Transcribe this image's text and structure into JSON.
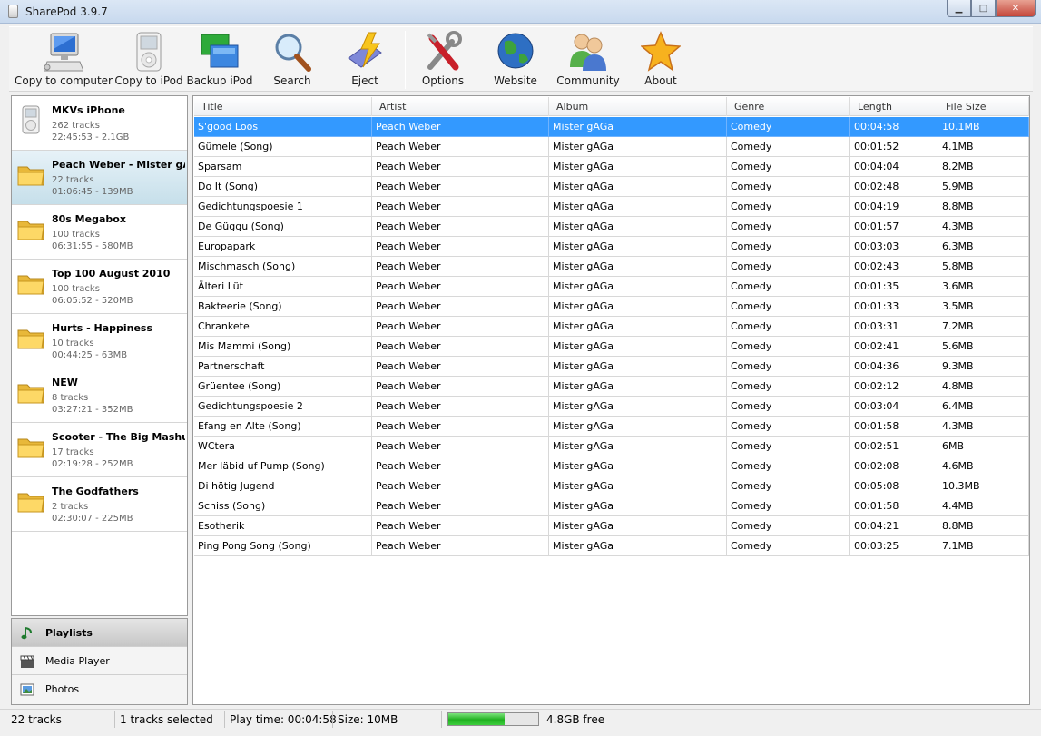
{
  "window": {
    "title": "SharePod 3.9.7",
    "min": "▁",
    "max": "□",
    "close": "✕"
  },
  "toolbar": [
    {
      "id": "copy-to-computer",
      "label": "Copy to computer",
      "icon": "computer-icon"
    },
    {
      "id": "copy-to-ipod",
      "label": "Copy to iPod",
      "icon": "ipod-icon"
    },
    {
      "id": "backup-ipod",
      "label": "Backup iPod",
      "icon": "backup-icon"
    },
    {
      "id": "search",
      "label": "Search",
      "icon": "magnifier-icon"
    },
    {
      "id": "eject",
      "label": "Eject",
      "icon": "eject-icon"
    },
    {
      "id": "options",
      "label": "Options",
      "icon": "tools-icon"
    },
    {
      "id": "website",
      "label": "Website",
      "icon": "globe-icon"
    },
    {
      "id": "community",
      "label": "Community",
      "icon": "people-icon"
    },
    {
      "id": "about",
      "label": "About",
      "icon": "star-icon"
    }
  ],
  "playlists": [
    {
      "name": "MKVs iPhone",
      "tracks": "262 tracks",
      "meta": "22:45:53 - 2.1GB",
      "icon": "ipod-icon",
      "selected": false
    },
    {
      "name": "Peach Weber - Mister gA",
      "tracks": "22 tracks",
      "meta": "01:06:45 - 139MB",
      "icon": "folder-icon",
      "selected": true
    },
    {
      "name": "80s Megabox",
      "tracks": "100 tracks",
      "meta": "06:31:55 - 580MB",
      "icon": "folder-icon",
      "selected": false
    },
    {
      "name": "Top 100 August 2010",
      "tracks": "100 tracks",
      "meta": "06:05:52 - 520MB",
      "icon": "folder-icon",
      "selected": false
    },
    {
      "name": "Hurts - Happiness",
      "tracks": "10 tracks",
      "meta": "00:44:25 - 63MB",
      "icon": "folder-icon",
      "selected": false
    },
    {
      "name": "NEW",
      "tracks": "8 tracks",
      "meta": "03:27:21 - 352MB",
      "icon": "folder-icon",
      "selected": false
    },
    {
      "name": "Scooter - The Big Mashup",
      "tracks": "17 tracks",
      "meta": "02:19:28 - 252MB",
      "icon": "folder-icon",
      "selected": false
    },
    {
      "name": "The Godfathers",
      "tracks": "2 tracks",
      "meta": "02:30:07 - 225MB",
      "icon": "folder-icon",
      "selected": false
    }
  ],
  "nav": [
    {
      "label": "Playlists",
      "icon": "music-note-icon",
      "active": true
    },
    {
      "label": "Media Player",
      "icon": "clapperboard-icon",
      "active": false
    },
    {
      "label": "Photos",
      "icon": "photo-icon",
      "active": false
    }
  ],
  "table": {
    "columns": [
      "Title",
      "Artist",
      "Album",
      "Genre",
      "Length",
      "File Size"
    ],
    "rows": [
      [
        "S'good Loos",
        "Peach Weber",
        "Mister gAGa",
        "Comedy",
        "00:04:58",
        "10.1MB"
      ],
      [
        "Gümele (Song)",
        "Peach Weber",
        "Mister gAGa",
        "Comedy",
        "00:01:52",
        "4.1MB"
      ],
      [
        "Sparsam",
        "Peach Weber",
        "Mister gAGa",
        "Comedy",
        "00:04:04",
        "8.2MB"
      ],
      [
        "Do It (Song)",
        "Peach Weber",
        "Mister gAGa",
        "Comedy",
        "00:02:48",
        "5.9MB"
      ],
      [
        "Gedichtungspoesie 1",
        "Peach Weber",
        "Mister gAGa",
        "Comedy",
        "00:04:19",
        "8.8MB"
      ],
      [
        "De Güggu (Song)",
        "Peach Weber",
        "Mister gAGa",
        "Comedy",
        "00:01:57",
        "4.3MB"
      ],
      [
        "Europapark",
        "Peach Weber",
        "Mister gAGa",
        "Comedy",
        "00:03:03",
        "6.3MB"
      ],
      [
        "Mischmasch (Song)",
        "Peach Weber",
        "Mister gAGa",
        "Comedy",
        "00:02:43",
        "5.8MB"
      ],
      [
        "Älteri Lüt",
        "Peach Weber",
        "Mister gAGa",
        "Comedy",
        "00:01:35",
        "3.6MB"
      ],
      [
        "Bakteerie (Song)",
        "Peach Weber",
        "Mister gAGa",
        "Comedy",
        "00:01:33",
        "3.5MB"
      ],
      [
        "Chrankete",
        "Peach Weber",
        "Mister gAGa",
        "Comedy",
        "00:03:31",
        "7.2MB"
      ],
      [
        "Mis Mammi (Song)",
        "Peach Weber",
        "Mister gAGa",
        "Comedy",
        "00:02:41",
        "5.6MB"
      ],
      [
        "Partnerschaft",
        "Peach Weber",
        "Mister gAGa",
        "Comedy",
        "00:04:36",
        "9.3MB"
      ],
      [
        "Grüentee (Song)",
        "Peach Weber",
        "Mister gAGa",
        "Comedy",
        "00:02:12",
        "4.8MB"
      ],
      [
        "Gedichtungspoesie 2",
        "Peach Weber",
        "Mister gAGa",
        "Comedy",
        "00:03:04",
        "6.4MB"
      ],
      [
        "Efang en Alte (Song)",
        "Peach Weber",
        "Mister gAGa",
        "Comedy",
        "00:01:58",
        "4.3MB"
      ],
      [
        "WCtera",
        "Peach Weber",
        "Mister gAGa",
        "Comedy",
        "00:02:51",
        "6MB"
      ],
      [
        "Mer läbid uf Pump (Song)",
        "Peach Weber",
        "Mister gAGa",
        "Comedy",
        "00:02:08",
        "4.6MB"
      ],
      [
        "Di hötig Jugend",
        "Peach Weber",
        "Mister gAGa",
        "Comedy",
        "00:05:08",
        "10.3MB"
      ],
      [
        "Schiss (Song)",
        "Peach Weber",
        "Mister gAGa",
        "Comedy",
        "00:01:58",
        "4.4MB"
      ],
      [
        "Esotherik",
        "Peach Weber",
        "Mister gAGa",
        "Comedy",
        "00:04:21",
        "8.8MB"
      ],
      [
        "Ping Pong Song (Song)",
        "Peach Weber",
        "Mister gAGa",
        "Comedy",
        "00:03:25",
        "7.1MB"
      ]
    ],
    "selected_row": 0
  },
  "status": {
    "tracks": "22 tracks",
    "selected": "1 tracks selected",
    "playtime": "Play time: 00:04:58",
    "size": "Size: 10MB",
    "free": "4.8GB free",
    "used_fraction": 0.63
  },
  "colors": {
    "selection": "#3399ff",
    "progress": "#20b020",
    "accent": "#c4463a"
  }
}
